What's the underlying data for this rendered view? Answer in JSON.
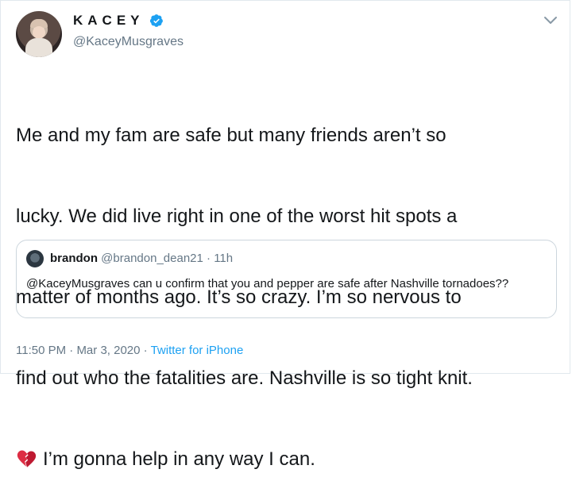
{
  "author": {
    "display_name": "KACEY",
    "handle": "@KaceyMusgraves",
    "verified": true
  },
  "tweet": {
    "lines": [
      "Me and my fam are safe but many friends aren’t so",
      "lucky. We did live right in one of the worst hit spots a",
      "matter of months ago. It’s so crazy. I’m so nervous to",
      "find out who the fatalities are. Nashville is so tight knit.",
      "I’m gonna help in any way I can."
    ],
    "emoji": "broken-heart-icon"
  },
  "quoted_tweet": {
    "name": "brandon",
    "handle": "@brandon_dean21",
    "separator": "·",
    "time": "11h",
    "text": "@KaceyMusgraves can u confirm that you and pepper are safe after Nashville tornadoes??"
  },
  "meta": {
    "time": "11:50 PM",
    "separator": "·",
    "date": "Mar 3, 2020",
    "source": "Twitter for iPhone"
  },
  "colors": {
    "link_blue": "#1da1f2",
    "secondary_text": "#657786",
    "border": "#ccd6dd",
    "broken_heart_red": "#dd2e44"
  }
}
